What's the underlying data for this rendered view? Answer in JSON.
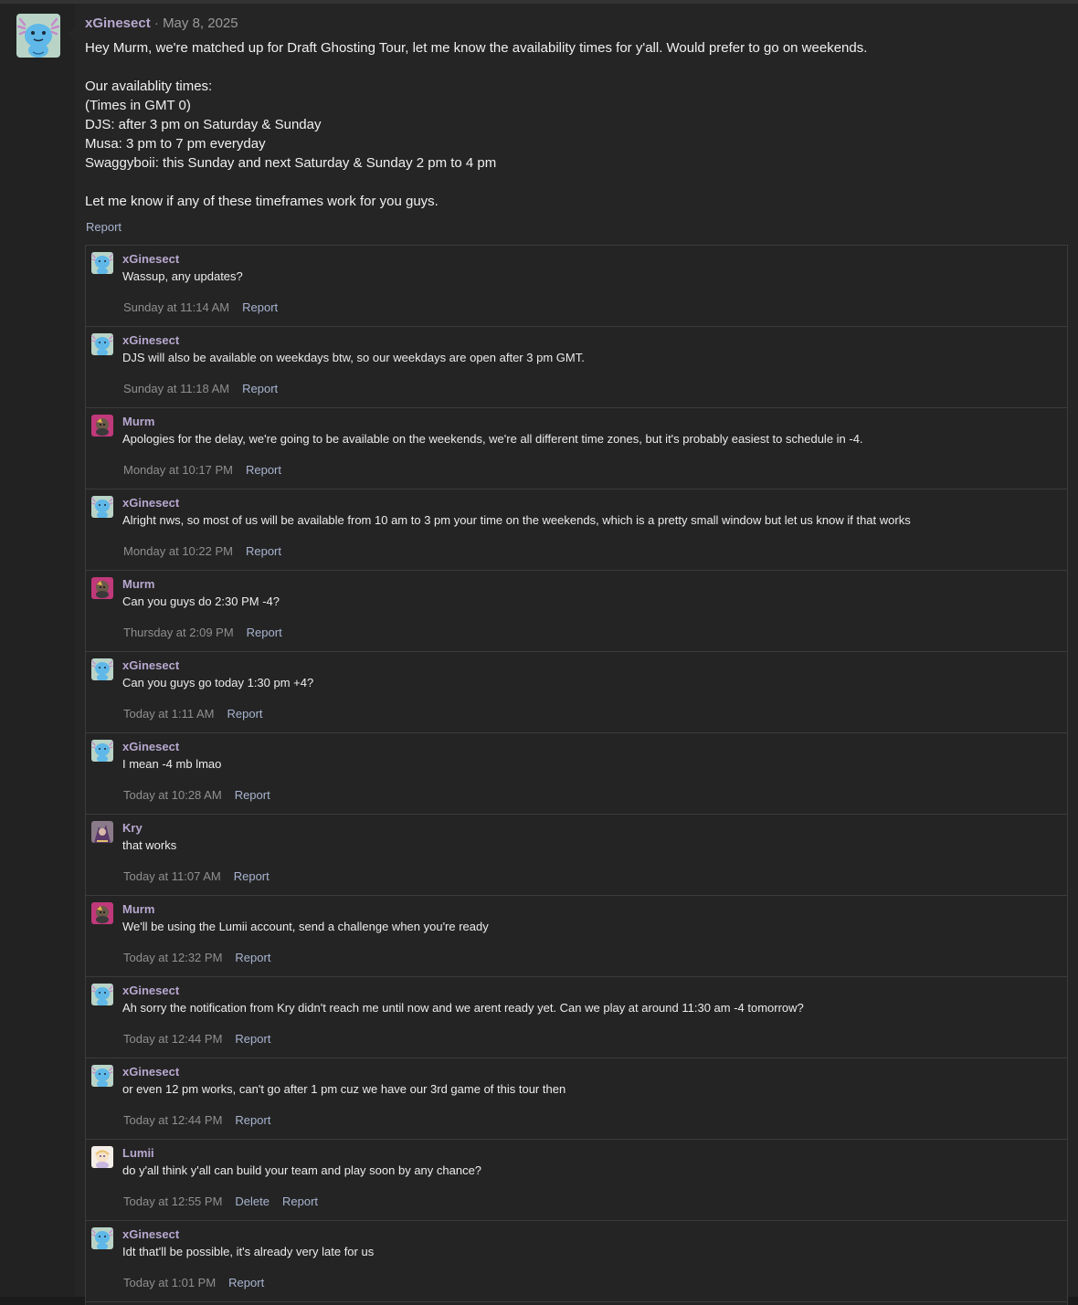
{
  "post": {
    "author": "xGinesect",
    "separator": "·",
    "date": "May 8, 2025",
    "lines": [
      "Hey Murm, we're matched up for Draft Ghosting Tour, let me know the availability times for y'all. Would prefer to go on weekends.",
      "",
      "Our availablity times:",
      "(Times in GMT 0)",
      "DJS: after 3 pm on Saturday & Sunday",
      "Musa: 3 pm to 7 pm everyday",
      "Swaggyboii: this Sunday and next Saturday & Sunday 2 pm to 4 pm",
      "",
      "Let me know if any of these timeframes work for you guys."
    ],
    "report_label": "Report"
  },
  "comments": [
    {
      "author": "xGinesect",
      "avatar": "wooper-avatar",
      "text": "Wassup, any updates?",
      "time": "Sunday at 11:14 AM",
      "actions": [
        "Report"
      ]
    },
    {
      "author": "xGinesect",
      "avatar": "wooper-avatar",
      "text": "DJS will also be available on weekdays btw, so our weekdays are open after 3 pm GMT.",
      "time": "Sunday at 11:18 AM",
      "actions": [
        "Report"
      ]
    },
    {
      "author": "Murm",
      "avatar": "murm-avatar",
      "text": "Apologies for the delay, we're going to be available on the weekends, we're all different time zones, but it's probably easiest to schedule in -4.",
      "time": "Monday at 10:17 PM",
      "actions": [
        "Report"
      ]
    },
    {
      "author": "xGinesect",
      "avatar": "wooper-avatar",
      "text": "Alright nws, so most of us will be available from 10 am to 3 pm your time on the weekends, which is a pretty small window but let us know if that works",
      "time": "Monday at 10:22 PM",
      "actions": [
        "Report"
      ]
    },
    {
      "author": "Murm",
      "avatar": "murm-avatar",
      "text": "Can you guys do 2:30 PM -4?",
      "time": "Thursday at 2:09 PM",
      "actions": [
        "Report"
      ]
    },
    {
      "author": "xGinesect",
      "avatar": "wooper-avatar",
      "text": "Can you guys go today 1:30 pm +4?",
      "time": "Today at 1:11 AM",
      "actions": [
        "Report"
      ]
    },
    {
      "author": "xGinesect",
      "avatar": "wooper-avatar",
      "text": "I mean -4 mb lmao",
      "time": "Today at 10:28 AM",
      "actions": [
        "Report"
      ]
    },
    {
      "author": "Kry",
      "avatar": "kry-avatar",
      "text": "that works",
      "time": "Today at 11:07 AM",
      "actions": [
        "Report"
      ]
    },
    {
      "author": "Murm",
      "avatar": "murm-avatar",
      "text": "We'll be using the Lumii account, send a challenge when you're ready",
      "time": "Today at 12:32 PM",
      "actions": [
        "Report"
      ]
    },
    {
      "author": "xGinesect",
      "avatar": "wooper-avatar",
      "text": "Ah sorry the notification from Kry didn't reach me until now and we arent ready yet. Can we play at around 11:30 am -4 tomorrow?",
      "time": "Today at 12:44 PM",
      "actions": [
        "Report"
      ]
    },
    {
      "author": "xGinesect",
      "avatar": "wooper-avatar",
      "text": "or even 12 pm works, can't go after 1 pm cuz we have our 3rd game of this tour then",
      "time": "Today at 12:44 PM",
      "actions": [
        "Report"
      ]
    },
    {
      "author": "Lumii",
      "avatar": "lumii-avatar",
      "text": "do y'all think y'all can build your team and play soon by any chance?",
      "time": "Today at 12:55 PM",
      "actions": [
        "Delete",
        "Report"
      ]
    },
    {
      "author": "xGinesect",
      "avatar": "wooper-avatar",
      "text": "Idt that'll be possible, it's already very late for us",
      "time": "Today at 1:01 PM",
      "actions": [
        "Report"
      ]
    }
  ],
  "colors": {
    "username": "#b7a8cf",
    "link": "#a8b4d0",
    "timestamp": "#8f8f8f",
    "background": "#252525"
  }
}
